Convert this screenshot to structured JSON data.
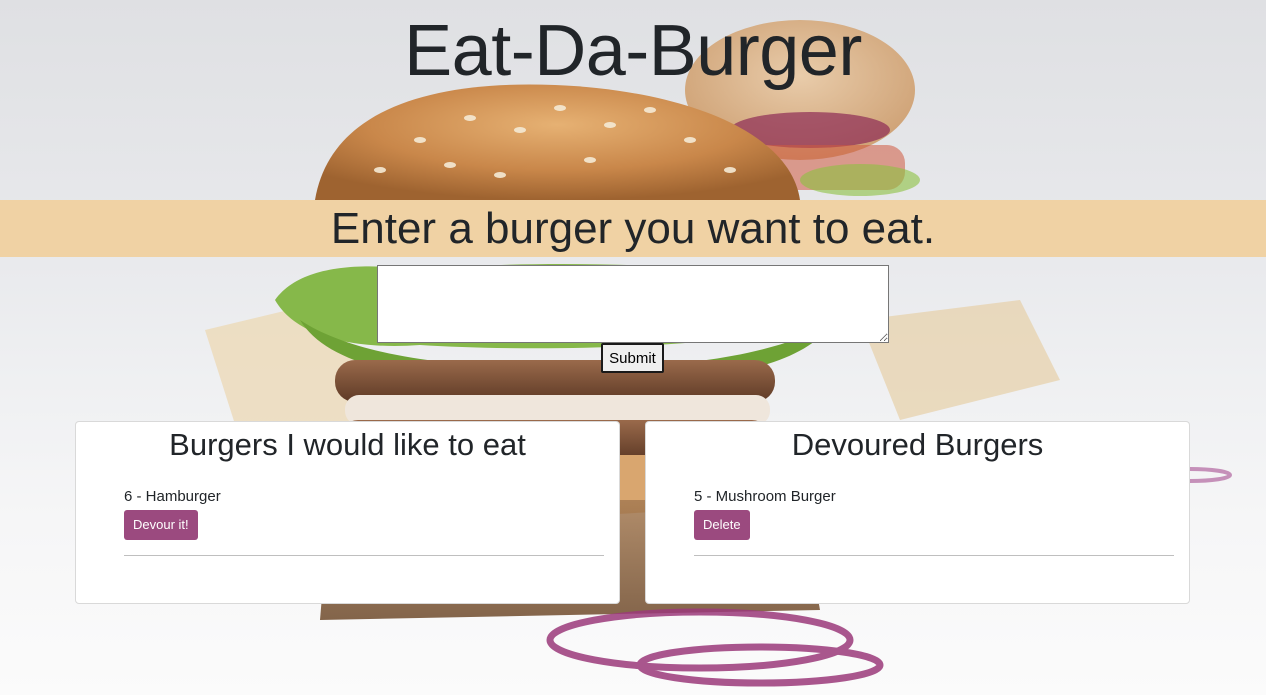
{
  "header": {
    "title": "Eat-Da-Burger",
    "prompt": "Enter a burger you want to eat."
  },
  "form": {
    "input_value": "",
    "submit_label": "Submit"
  },
  "to_eat": {
    "title": "Burgers I would like to eat",
    "items": [
      {
        "label": "6 - Hamburger",
        "button": "Devour it!"
      }
    ]
  },
  "devoured": {
    "title": "Devoured Burgers",
    "items": [
      {
        "label": "5 - Mushroom Burger",
        "button": "Delete"
      }
    ]
  },
  "colors": {
    "band": "#f0d1a0",
    "button": "#9b4a7f",
    "text": "#212529"
  },
  "icons": {
    "background": "burger-photo-image"
  }
}
